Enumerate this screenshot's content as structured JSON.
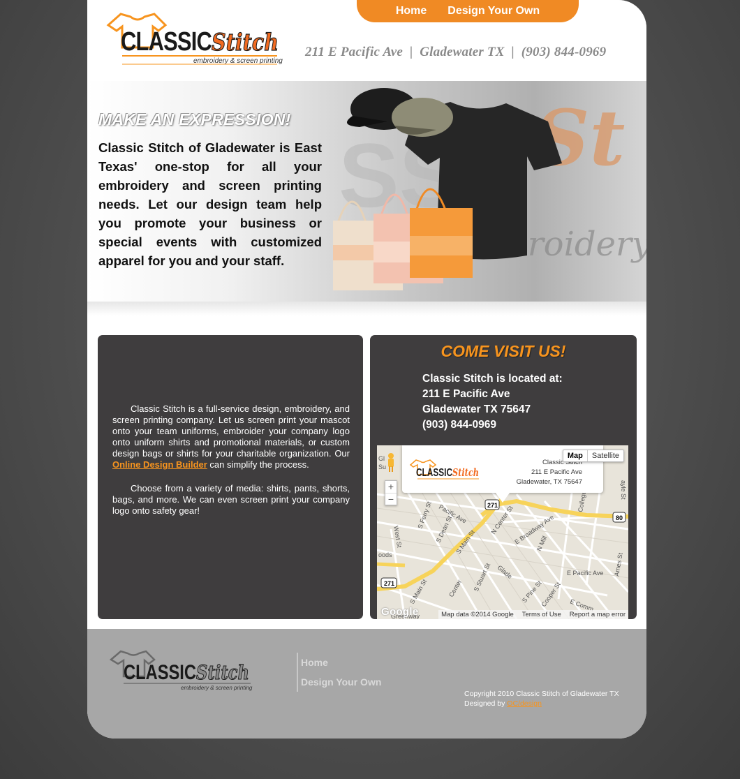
{
  "header": {
    "logo_alt": "Classic Stitch",
    "logo_word1": "CLASSIC",
    "logo_word2": "Stitch",
    "logo_tagline": "embroidery & screen printing",
    "nav": {
      "home": "Home",
      "design": "Design Your Own"
    },
    "address_line": "211 E Pacific Ave  |  Gladewater TX  |  (903) 844-0969"
  },
  "hero": {
    "title": "MAKE AN EXPRESSION!",
    "text": "Classic Stitch of Gladewater is East Texas' one-stop for all your embroidery and screen printing needs. Let our design team help you promote your business or special events with customized apparel for you and your staff."
  },
  "about": {
    "p1_before": "Classic Stitch is a full-service design, embroidery, and screen printing company. Let us screen print your mascot onto your team uniforms, embroider your company logo onto uniform shirts and promotional materials, or custom design bags or shirts for your charitable organization. Our ",
    "p1_link": "Online Design Builder",
    "p1_after": " can simplify the process.",
    "p2": "Choose from a variety of media: shirts, pants, shorts, bags, and more. We can even screen print your company logo onto safety gear!"
  },
  "visit": {
    "title": "COME VISIT US!",
    "line1": "Classic Stitch is located at:",
    "line2": "211 E Pacific Ave",
    "line3": "Gladewater TX 75647",
    "line4": "(903) 844-0969"
  },
  "map": {
    "type_map": "Map",
    "type_satellite": "Satellite",
    "zoom_in": "+",
    "zoom_out": "−",
    "info_name": "Classic Stitch",
    "info_street": "211 E Pacific Ave",
    "info_city": "Gladewater, TX 75647",
    "google": "Google",
    "attrib_data": "Map data ©2014 Google",
    "attrib_terms": "Terms of Use",
    "attrib_report": "Report a map error",
    "roads": {
      "s_main": "S Main St",
      "pacific_ave": "Pacific Ave",
      "e_pacific": "E Pacific Ave",
      "n_center": "N Center St",
      "e_broadway": "E Broadway Ave",
      "n_mill": "N Mill",
      "s_ferry": "S Ferry St",
      "s_dean": "S Dean St",
      "west_st": "West St",
      "s_stuart": "S Stuart St",
      "glade": "Glade",
      "center": "Center",
      "s_pine": "S Pine St",
      "cooper": "Cooper St",
      "e_commerce": "E Comm",
      "ames": "Ames St",
      "college": "College",
      "woods": "oods",
      "greenway": "Greenway",
      "hwy271": "271",
      "hwy80": "80",
      "s_main2": "S Main St",
      "ayle": "ayle St",
      "gl": "Gl",
      "su": "Su"
    }
  },
  "footer": {
    "nav": {
      "home": "Home",
      "design": "Design Your Own"
    },
    "copyright": "Copyright 2010 Classic Stitch of Gladewater TX",
    "designed_by": "Designed by ",
    "designer": "OC/design"
  },
  "colors": {
    "accent": "#f7941e",
    "dark_panel": "#3f3d3e",
    "footer": "#a7a7a7"
  }
}
